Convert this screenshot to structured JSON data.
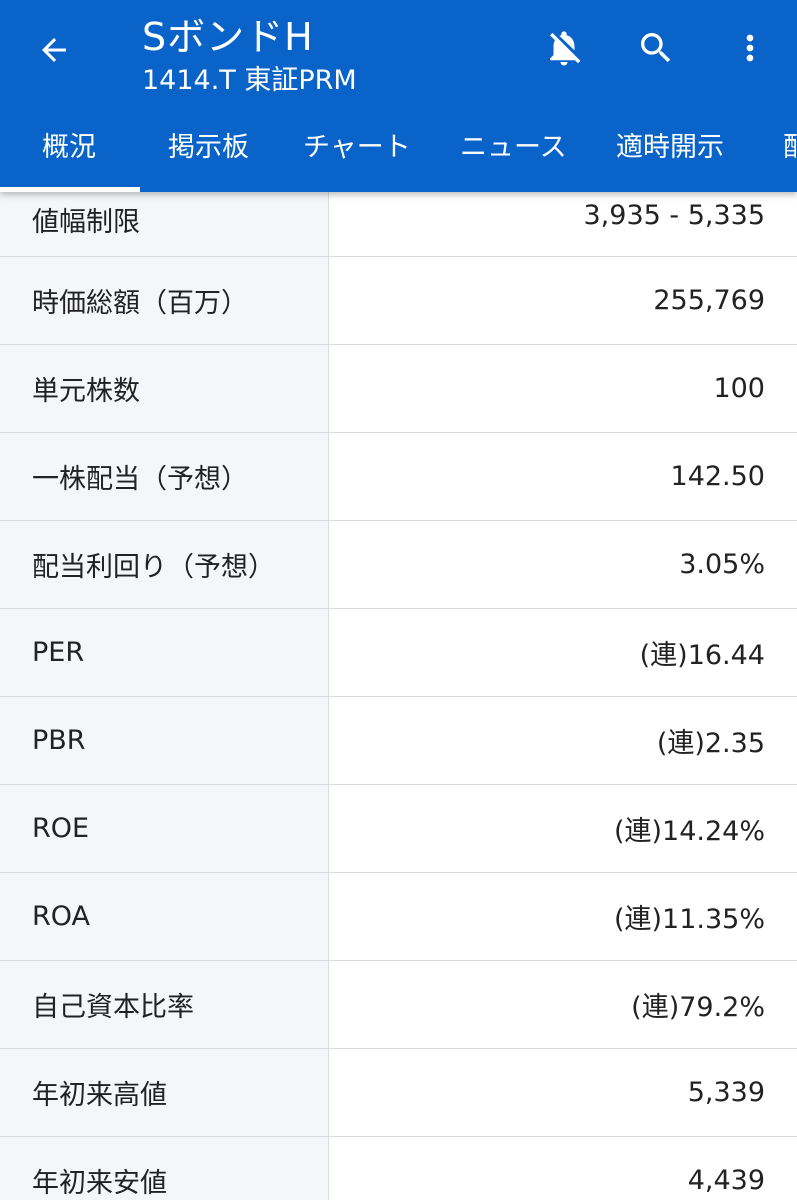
{
  "header": {
    "title": "SボンドH",
    "subtitle": "1414.T 東証PRM",
    "back_icon": "arrow-back-icon",
    "notification_icon": "bell-off-icon",
    "search_icon": "search-icon",
    "more_icon": "more-vert-icon"
  },
  "colors": {
    "header_bg": "#0a63c9",
    "label_bg": "#f4f6f9",
    "divider": "#dcdcdc",
    "text": "#222222"
  },
  "tabs": [
    {
      "label": "概況",
      "active": true
    },
    {
      "label": "掲示板"
    },
    {
      "label": "チャート"
    },
    {
      "label": "ニュース"
    },
    {
      "label": "適時開示"
    },
    {
      "label": "配"
    }
  ],
  "rows": [
    {
      "label": "値幅制限",
      "value": "3,935 - 5,335"
    },
    {
      "label": "時価総額（百万）",
      "value": "255,769"
    },
    {
      "label": "単元株数",
      "value": "100"
    },
    {
      "label": "一株配当（予想）",
      "value": "142.50"
    },
    {
      "label": "配当利回り（予想）",
      "value": "3.05%"
    },
    {
      "label": "PER",
      "value": "(連)16.44"
    },
    {
      "label": "PBR",
      "value": "(連)2.35"
    },
    {
      "label": "ROE",
      "value": "(連)14.24%"
    },
    {
      "label": "ROA",
      "value": "(連)11.35%"
    },
    {
      "label": "自己資本比率",
      "value": "(連)79.2%"
    },
    {
      "label": "年初来高値",
      "value": "5,339"
    },
    {
      "label": "年初来安値",
      "value": "4,439"
    }
  ]
}
